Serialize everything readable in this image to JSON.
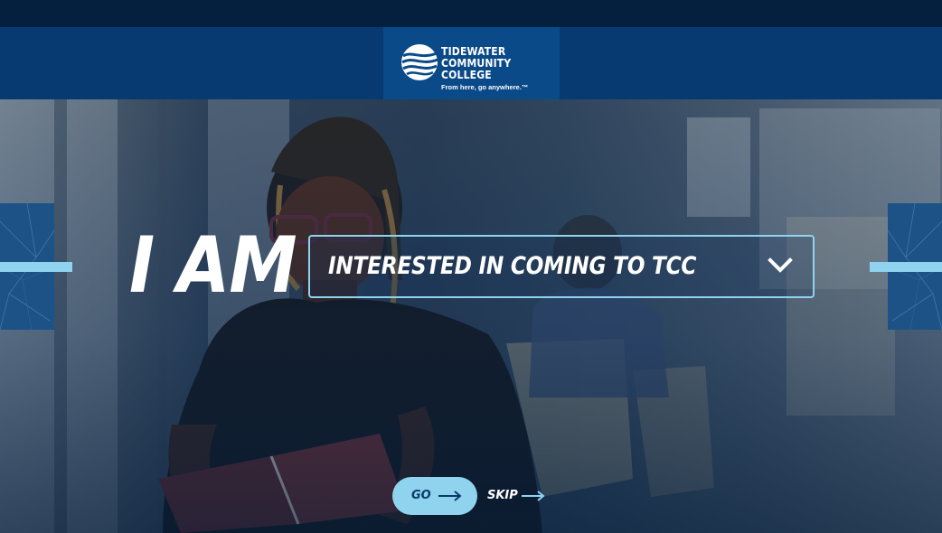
{
  "header": {
    "logo": {
      "line1": "TIDEWATER",
      "line2": "COMMUNITY COLLEGE",
      "tagline": "From here, go anywhere.™",
      "icon": "tcc-wave-logo-icon"
    }
  },
  "hero": {
    "image": "student-reading-book-photo",
    "prefix": "I AM",
    "selector": {
      "selected": "INTERESTED IN COMING TO TCC",
      "icon": "chevron-down-icon"
    },
    "go_label": "GO",
    "skip_label": "SKIP",
    "arrow_icon": "arrow-right-icon"
  },
  "colors": {
    "navy": "#063a70",
    "accent": "#8fd3ee",
    "dark": "#05203f"
  }
}
